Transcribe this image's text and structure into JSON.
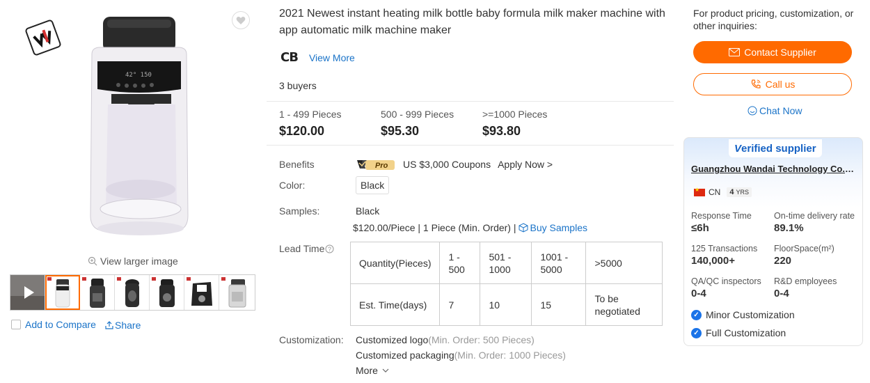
{
  "gallery": {
    "view_larger": "View larger image",
    "add_to_compare": "Add to Compare",
    "share": "Share",
    "thumbnails": [
      "video",
      "white-machine",
      "black-machine-front",
      "black-machine-tilt",
      "black-machine-side",
      "black-machine-top",
      "white-machine-side"
    ]
  },
  "product": {
    "title": "2021 Newest instant heating milk bottle baby formula milk maker machine with app automatic milk machine maker",
    "brand_mark": "CB",
    "view_more": "View More",
    "buyers": "3 buyers",
    "price_tiers": [
      {
        "qty": "1 - 499 Pieces",
        "price": "$120.00"
      },
      {
        "qty": "500 - 999 Pieces",
        "price": "$95.30"
      },
      {
        "qty": ">=1000 Pieces",
        "price": "$93.80"
      }
    ],
    "benefits_label": "Benefits",
    "benefit_badge": "Pro",
    "coupon": "US $3,000 Coupons",
    "apply_now": "Apply Now >",
    "color_label": "Color:",
    "color_value": "Black",
    "samples_label": "Samples:",
    "samples_value": "Black",
    "samples_price": "$120.00/Piece | 1 Piece (Min. Order) |",
    "buy_samples": "Buy Samples",
    "lead_time_label": "Lead Time",
    "lead_time": {
      "row1_label": "Quantity(Pieces)",
      "row1": [
        "1 - 500",
        "501 - 1000",
        "1001 - 5000",
        ">5000"
      ],
      "row2_label": "Est. Time(days)",
      "row2": [
        "7",
        "10",
        "15",
        "To be negotiated"
      ]
    },
    "customization_label": "Customization:",
    "customization": [
      {
        "name": "Customized logo",
        "min": "(Min. Order: 500 Pieces)"
      },
      {
        "name": "Customized packaging",
        "min": "(Min. Order: 1000 Pieces)"
      }
    ],
    "more": "More"
  },
  "contact": {
    "inquiry_text": "For product pricing, customization, or other inquiries:",
    "contact_supplier": "Contact Supplier",
    "call_us": "Call us",
    "chat_now": "Chat Now"
  },
  "supplier": {
    "verified_v": "V",
    "verified_rest": "erified supplier",
    "company": "Guangzhou Wandai Technology Co., Ltd.",
    "country": "CN",
    "years": "4",
    "years_unit": "YRS",
    "stats": [
      {
        "key": "Response Time",
        "value": "≤6h"
      },
      {
        "key": "On-time delivery rate",
        "value": "89.1%"
      },
      {
        "key": "125 Transactions",
        "value": "140,000+"
      },
      {
        "key": "FloorSpace(m²)",
        "value": "220"
      },
      {
        "key": "QA/QC inspectors",
        "value": "0-4"
      },
      {
        "key": "R&D employees",
        "value": "0-4"
      }
    ],
    "custom_tags": [
      "Minor Customization",
      "Full Customization"
    ]
  },
  "colors": {
    "accent": "#ff6a00",
    "link": "#1a73c8",
    "verified": "#1662c4"
  }
}
